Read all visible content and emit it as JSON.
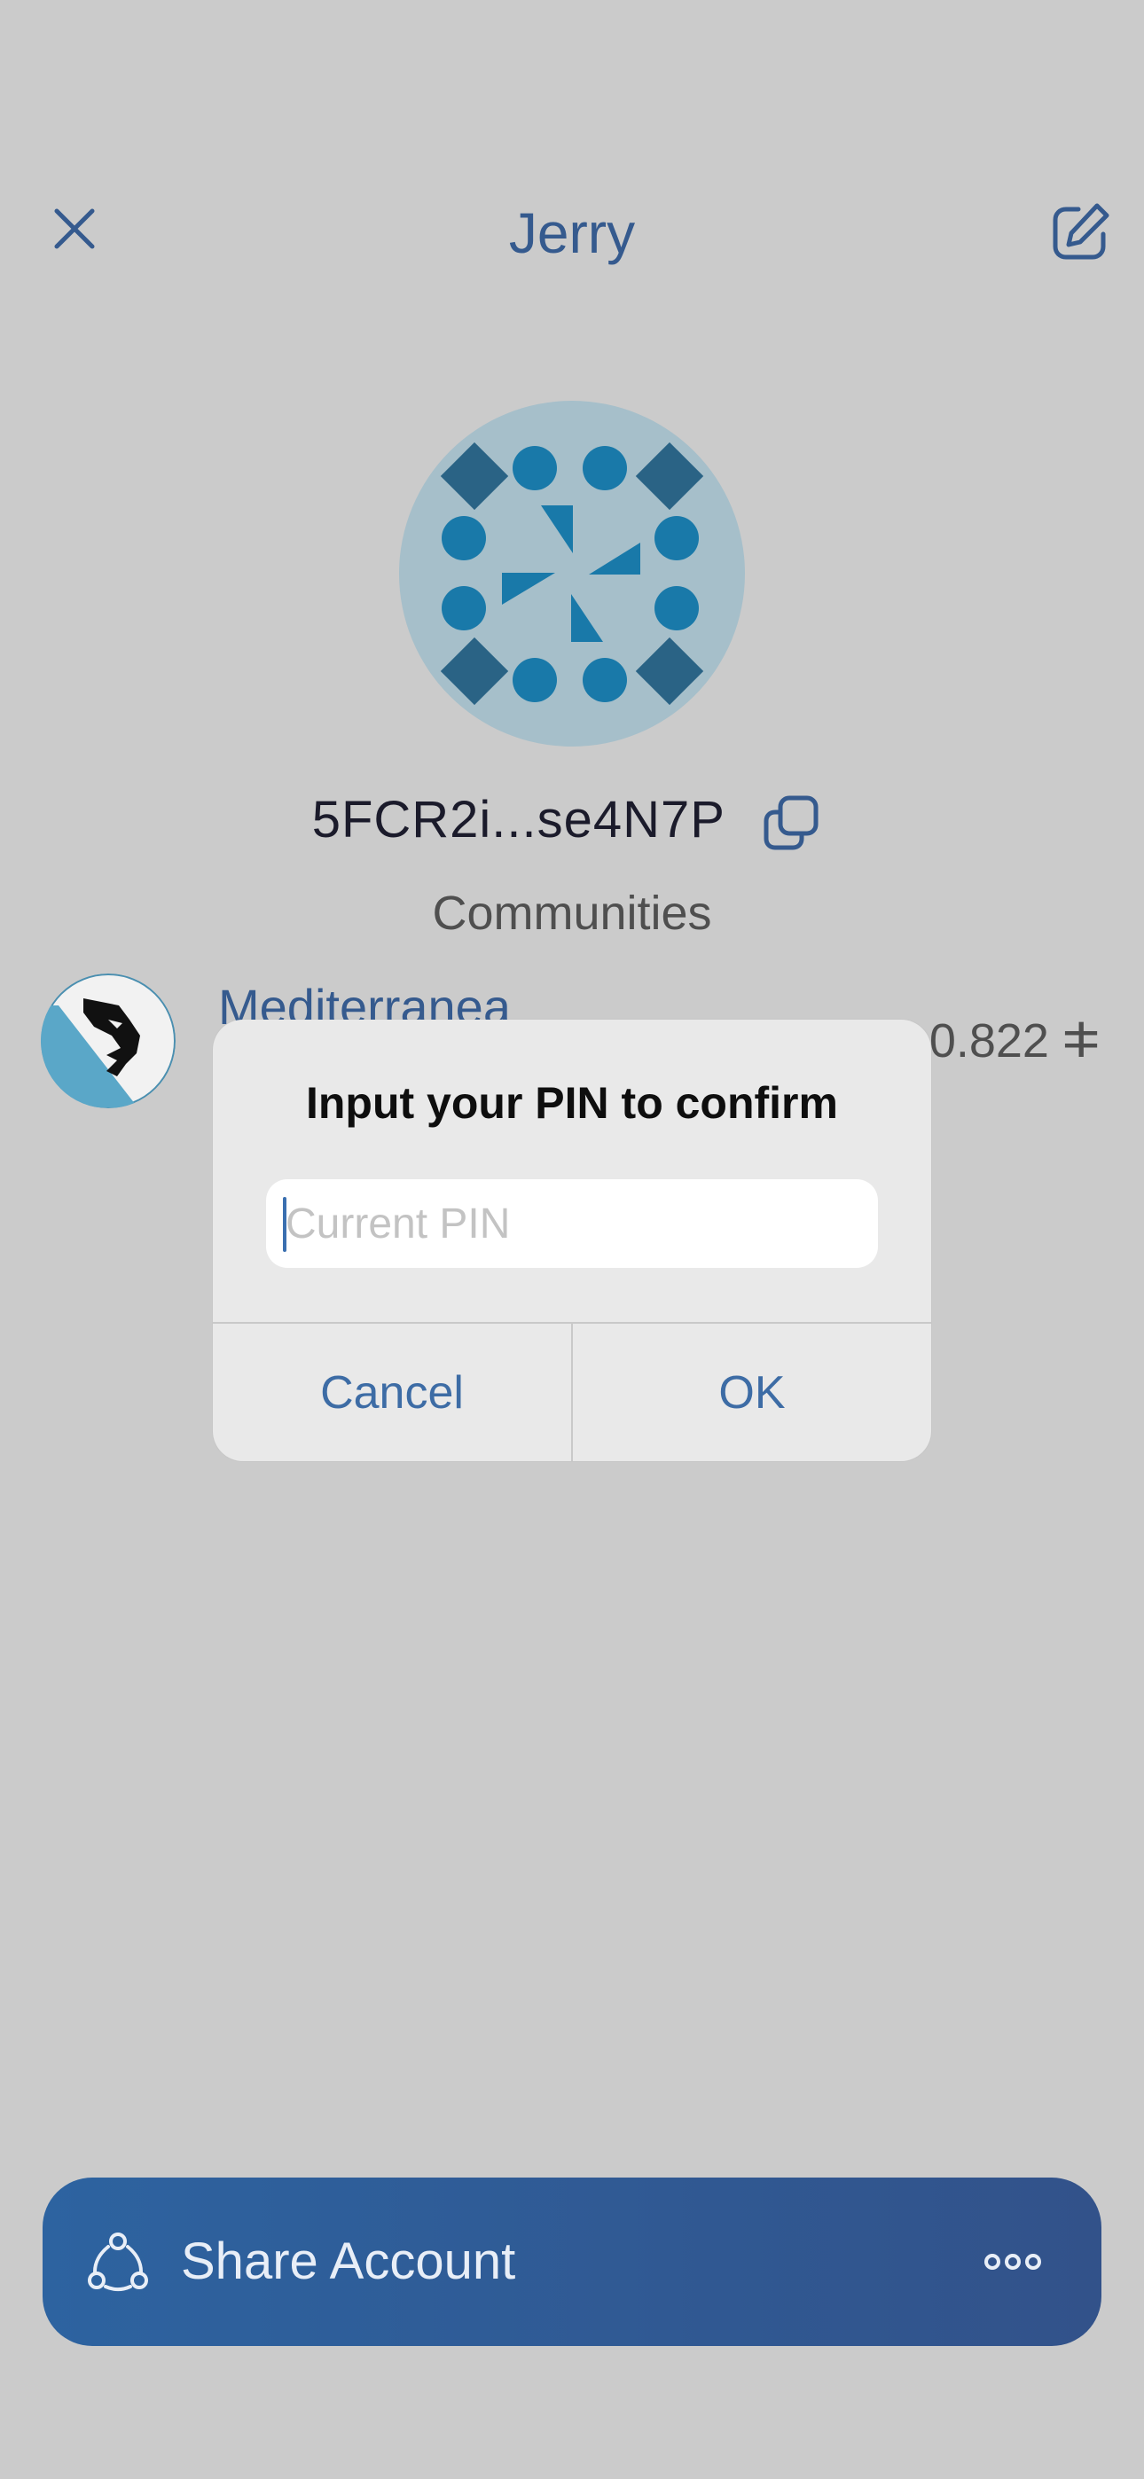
{
  "header": {
    "title": "Jerry",
    "close_icon": "close-icon",
    "edit_icon": "edit-icon"
  },
  "account": {
    "address": "5FCR2i...se4N7P",
    "copy_icon": "copy-icon",
    "identicon_colors": {
      "background": "#a6bfca",
      "dark": "#2a6385",
      "light": "#1979a9"
    }
  },
  "communities": {
    "section_title": "Communities",
    "items": [
      {
        "name": "Mediterranea",
        "balance": "0.822 ⵐ"
      }
    ]
  },
  "dialog": {
    "title": "Input your PIN to confirm",
    "pin_value": "",
    "pin_placeholder": "Current PIN",
    "cancel_label": "Cancel",
    "ok_label": "OK"
  },
  "share_bar": {
    "label": "Share Account",
    "share_icon": "share-icon",
    "more_icon": "more-icon"
  },
  "colors": {
    "accent": "#355a8e",
    "background": "#cbcbcb",
    "dialog_background": "#e9e9e9",
    "share_gradient_start": "#2d63a0",
    "share_gradient_end": "#32528a"
  }
}
